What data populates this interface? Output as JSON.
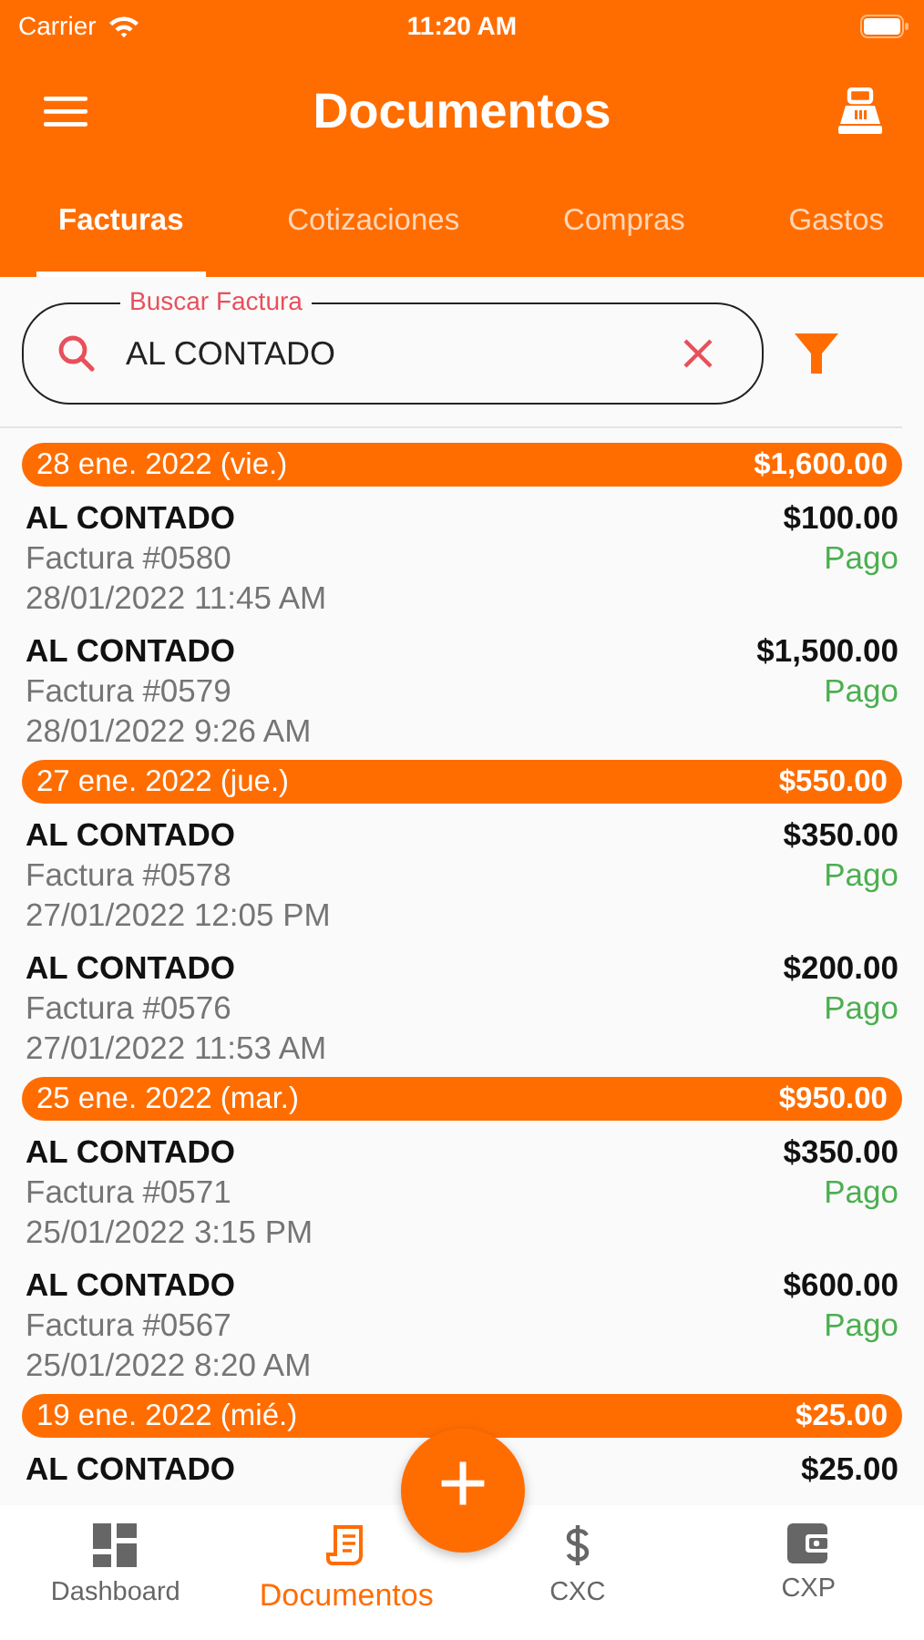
{
  "status_bar": {
    "carrier": "Carrier",
    "time": "11:20 AM"
  },
  "header": {
    "title": "Documentos"
  },
  "tabs": [
    {
      "label": "Facturas",
      "selected": true
    },
    {
      "label": "Cotizaciones",
      "selected": false
    },
    {
      "label": "Compras",
      "selected": false
    },
    {
      "label": "Gastos",
      "selected": false
    }
  ],
  "search": {
    "label": "Buscar Factura",
    "value": "AL CONTADO"
  },
  "groups": [
    {
      "date": "28 ene. 2022 (vie.)",
      "total": "$1,600.00",
      "items": [
        {
          "client": "AL CONTADO",
          "number": "Factura #0580",
          "datetime": "28/01/2022 11:45 AM",
          "amount": "$100.00",
          "status": "Pago"
        },
        {
          "client": "AL CONTADO",
          "number": "Factura #0579",
          "datetime": "28/01/2022 9:26 AM",
          "amount": "$1,500.00",
          "status": "Pago"
        }
      ]
    },
    {
      "date": "27 ene. 2022 (jue.)",
      "total": "$550.00",
      "items": [
        {
          "client": "AL CONTADO",
          "number": "Factura #0578",
          "datetime": "27/01/2022 12:05 PM",
          "amount": "$350.00",
          "status": "Pago"
        },
        {
          "client": "AL CONTADO",
          "number": "Factura #0576",
          "datetime": "27/01/2022 11:53 AM",
          "amount": "$200.00",
          "status": "Pago"
        }
      ]
    },
    {
      "date": "25 ene. 2022 (mar.)",
      "total": "$950.00",
      "items": [
        {
          "client": "AL CONTADO",
          "number": "Factura #0571",
          "datetime": "25/01/2022 3:15 PM",
          "amount": "$350.00",
          "status": "Pago"
        },
        {
          "client": "AL CONTADO",
          "number": "Factura #0567",
          "datetime": "25/01/2022 8:20 AM",
          "amount": "$600.00",
          "status": "Pago"
        }
      ]
    },
    {
      "date": "19 ene. 2022 (mié.)",
      "total": "$25.00",
      "items": [
        {
          "client": "AL CONTADO",
          "amount": "$25.00"
        }
      ]
    }
  ],
  "fab": {
    "label": "+"
  },
  "bottom_nav": [
    {
      "label": "Dashboard",
      "kind": "dashboard",
      "selected": false
    },
    {
      "label": "Documentos",
      "kind": "documents",
      "selected": true
    },
    {
      "label": "CXC",
      "kind": "dollar",
      "selected": false
    },
    {
      "label": "CXP",
      "kind": "wallet",
      "selected": false
    }
  ]
}
